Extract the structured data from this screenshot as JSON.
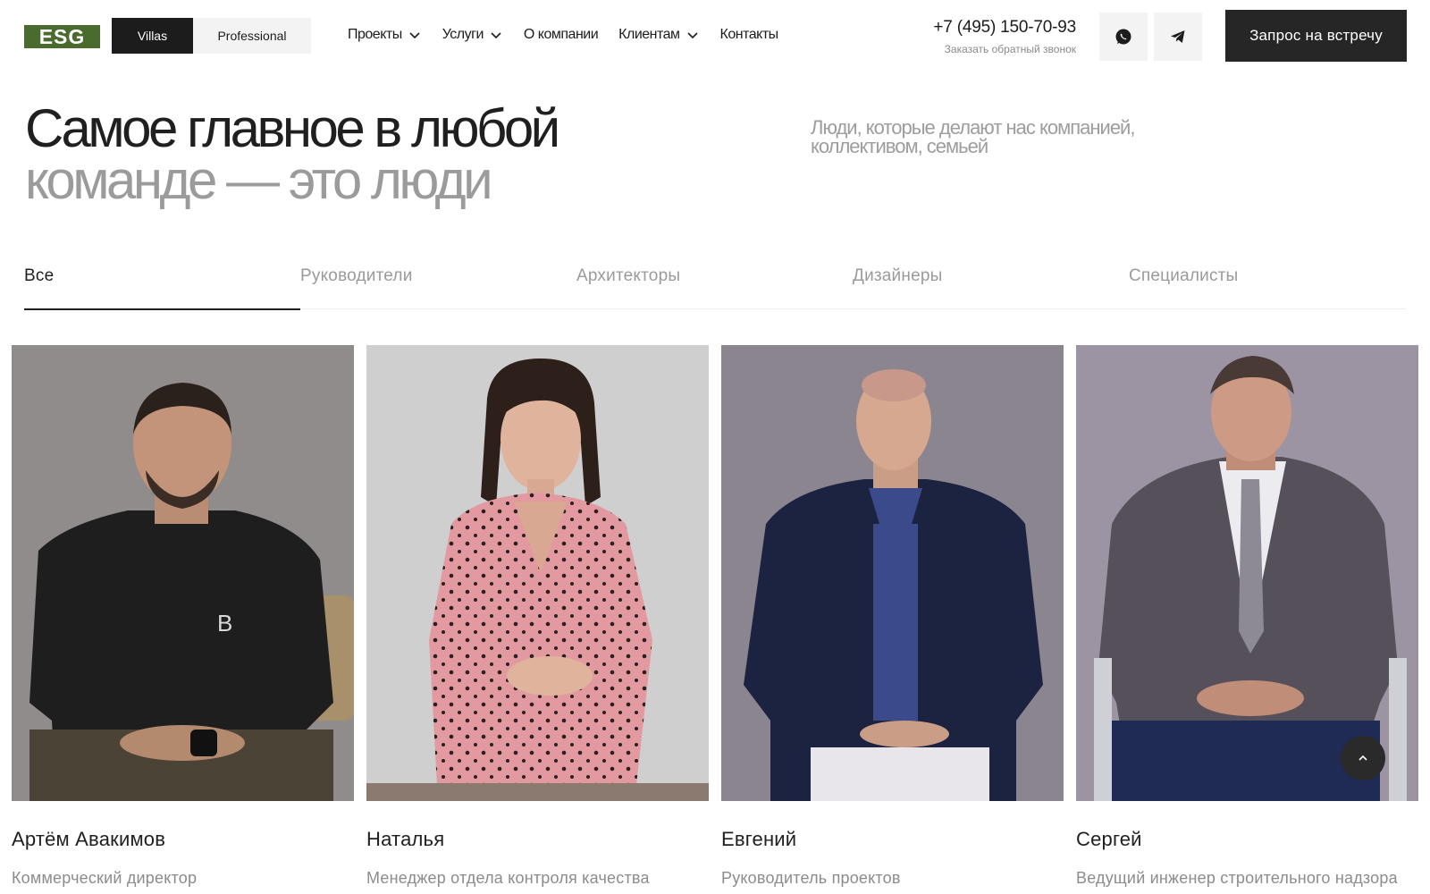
{
  "header": {
    "logo_text": "ESG",
    "brand_switch": [
      {
        "label": "Villas",
        "active": true
      },
      {
        "label": "Professional",
        "active": false
      }
    ],
    "nav": [
      {
        "label": "Проекты",
        "has_dropdown": true
      },
      {
        "label": "Услуги",
        "has_dropdown": true
      },
      {
        "label": "О компании",
        "has_dropdown": false
      },
      {
        "label": "Клиентам",
        "has_dropdown": true
      },
      {
        "label": "Контакты",
        "has_dropdown": false
      }
    ],
    "phone": "+7 (495) 150-70-93",
    "callback_label": "Заказать обратный звонок",
    "icons": [
      "whatsapp-icon",
      "telegram-icon"
    ],
    "meeting_button": "Запрос на встречу"
  },
  "hero": {
    "title_line1": "Самое главное в любой",
    "title_line2": "команде — это люди",
    "subtitle": "Люди, которые делают нас компанией, коллективом, семьей"
  },
  "tabs": [
    {
      "label": "Все",
      "active": true
    },
    {
      "label": "Руководители",
      "active": false
    },
    {
      "label": "Архитекторы",
      "active": false
    },
    {
      "label": "Дизайнеры",
      "active": false
    },
    {
      "label": "Специалисты",
      "active": false
    }
  ],
  "people": [
    {
      "name": "Артём Авакимов",
      "role": "Коммерческий директор"
    },
    {
      "name": "Наталья",
      "role": "Менеджер отдела контроля качества"
    },
    {
      "name": "Евгений",
      "role": "Руководитель проектов"
    },
    {
      "name": "Сергей",
      "role": "Ведущий инженер строительного надзора по инженерным системам"
    }
  ],
  "colors": {
    "logo_green": "#4a6b2e",
    "dark": "#1c1c1c",
    "muted_text": "#9b9b9b"
  }
}
